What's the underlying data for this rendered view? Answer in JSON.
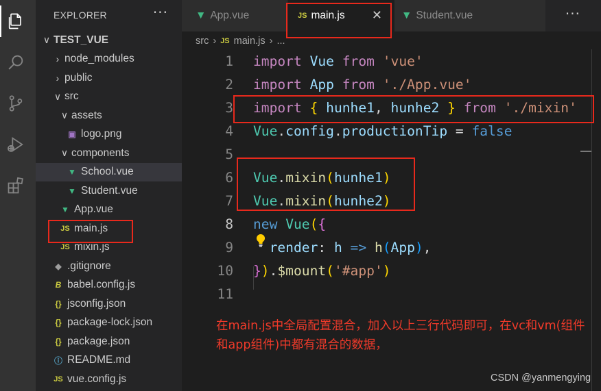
{
  "sidebar": {
    "header": "EXPLORER",
    "more": "···",
    "items": [
      {
        "label": "TEST_VUE",
        "chevron": "∨",
        "icon": "",
        "depth": 0,
        "bold": true
      },
      {
        "label": "node_modules",
        "chevron": "›",
        "icon": "",
        "depth": 1
      },
      {
        "label": "public",
        "chevron": "›",
        "icon": "",
        "depth": 1
      },
      {
        "label": "src",
        "chevron": "∨",
        "icon": "",
        "depth": 1
      },
      {
        "label": "assets",
        "chevron": "∨",
        "icon": "",
        "depth": 2
      },
      {
        "label": "logo.png",
        "chevron": "",
        "icon": "image-icon",
        "depth": 3
      },
      {
        "label": "components",
        "chevron": "∨",
        "icon": "",
        "depth": 2
      },
      {
        "label": "School.vue",
        "chevron": "",
        "icon": "vue-icon",
        "depth": 3,
        "selected": true
      },
      {
        "label": "Student.vue",
        "chevron": "",
        "icon": "vue-icon",
        "depth": 3
      },
      {
        "label": "App.vue",
        "chevron": "",
        "icon": "vue-icon",
        "depth": 2
      },
      {
        "label": "main.js",
        "chevron": "",
        "icon": "js-icon",
        "depth": 2
      },
      {
        "label": "mixin.js",
        "chevron": "",
        "icon": "js-icon",
        "depth": 2
      },
      {
        "label": ".gitignore",
        "chevron": "",
        "icon": "git-icon",
        "depth": 1
      },
      {
        "label": "babel.config.js",
        "chevron": "",
        "icon": "babel-icon",
        "depth": 1
      },
      {
        "label": "jsconfig.json",
        "chevron": "",
        "icon": "json-icon",
        "depth": 1
      },
      {
        "label": "package-lock.json",
        "chevron": "",
        "icon": "json-icon",
        "depth": 1
      },
      {
        "label": "package.json",
        "chevron": "",
        "icon": "json-icon",
        "depth": 1
      },
      {
        "label": "README.md",
        "chevron": "",
        "icon": "info-icon",
        "depth": 1
      },
      {
        "label": "vue.config.js",
        "chevron": "",
        "icon": "js-icon",
        "depth": 1
      }
    ]
  },
  "tabs": {
    "app": "App.vue",
    "main": "main.js",
    "student": "Student.vue",
    "close": "✕",
    "more": "···"
  },
  "breadcrumb": {
    "folder": "src",
    "sep": "›",
    "file_icon": "JS",
    "file": "main.js",
    "tail": "...",
    "tail_sep": "›"
  },
  "code": {
    "line_numbers": [
      "1",
      "2",
      "3",
      "4",
      "5",
      "6",
      "7",
      "8",
      "9",
      "10",
      "11"
    ],
    "current_line": "8",
    "l1": {
      "kw": "import",
      "name": "Vue",
      "from": "from",
      "str": "'vue'"
    },
    "l2": {
      "kw": "import",
      "name": "App",
      "from": "from",
      "str": "'./App.vue'"
    },
    "l3": {
      "kw": "import",
      "open": "{",
      "a": "hunhe1",
      "comma": ",",
      "b": "hunhe2",
      "close": "}",
      "from": "from",
      "str": "'./mixin'"
    },
    "l4": {
      "obj": "Vue",
      "dot1": ".",
      "prop1": "config",
      "dot2": ".",
      "prop2": "productionTip",
      "eq": " = ",
      "val": "false"
    },
    "l6": {
      "obj": "Vue",
      "dot": ".",
      "fn": "mixin",
      "open": "(",
      "arg": "hunhe1",
      "close": ")"
    },
    "l7": {
      "obj": "Vue",
      "dot": ".",
      "fn": "mixin",
      "open": "(",
      "arg": "hunhe2",
      "close": ")"
    },
    "l8": {
      "kw": "new",
      "cls": "Vue",
      "open1": "(",
      "open2": "{"
    },
    "l9": {
      "key": "render",
      "colon": ": ",
      "p": "h",
      "arrow": " => ",
      "fn": "h",
      "open": "(",
      "arg": "App",
      "close": ")",
      "comma": ","
    },
    "l10": {
      "close2": "}",
      "close1": ")",
      "dot": ".",
      "fn": "$mount",
      "open": "(",
      "str": "'#app'",
      "close": ")"
    }
  },
  "annotation": {
    "text": "在main.js中全局配置混合，加入以上三行代码即可，在vc和vm(组件和app组件)中都有混合的数据，",
    "color": "#f03a2a"
  },
  "watermark": "CSDN @yanmengying",
  "colors": {
    "highlight_box": "#e8291c",
    "vue_green": "#41b883",
    "js_yellow": "#cbcb41"
  }
}
